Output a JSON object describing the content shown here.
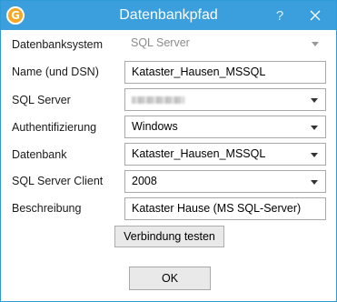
{
  "window": {
    "title": "Datenbankpfad",
    "app_icon_glyph": "G",
    "help_glyph": "?",
    "accent_color": "#3a9fdc"
  },
  "form": {
    "database_system": {
      "label": "Datenbanksystem",
      "value": "SQL Server",
      "enabled": false
    },
    "name": {
      "label": "Name (und DSN)",
      "value": "Kataster_Hausen_MSSQL"
    },
    "sql_server": {
      "label": "SQL Server",
      "value_redacted": true
    },
    "authentication": {
      "label": "Authentifizierung",
      "value": "Windows"
    },
    "database": {
      "label": "Datenbank",
      "value": "Kataster_Hausen_MSSQL"
    },
    "sql_server_client": {
      "label": "SQL Server Client",
      "value": "2008"
    },
    "description": {
      "label": "Beschreibung",
      "value": "Kataster Hause (MS SQL-Server)"
    }
  },
  "buttons": {
    "test_connection": "Verbindung testen",
    "ok": "OK"
  },
  "icons": {
    "app": "app-logo-icon",
    "help": "help-icon",
    "close": "close-icon",
    "dropdown": "chevron-down-icon"
  }
}
